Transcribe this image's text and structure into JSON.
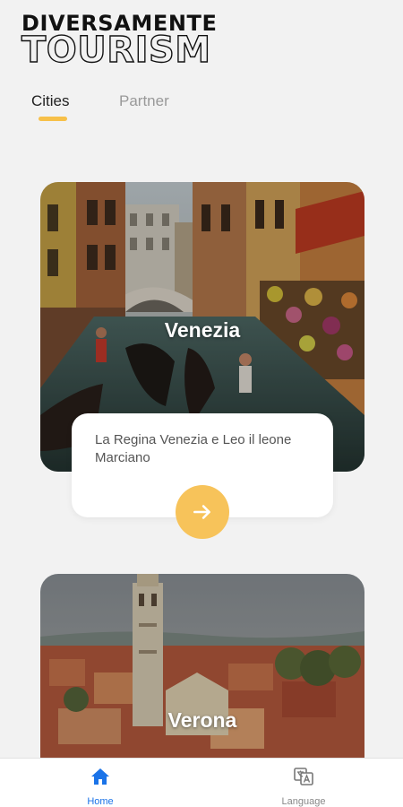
{
  "app": {
    "logo_line1": "DIVERSAMENTE",
    "logo_line2": "TOURISM"
  },
  "tabs": [
    {
      "label": "Cities",
      "active": true
    },
    {
      "label": "Partner",
      "active": false
    }
  ],
  "colors": {
    "accent": "#f7c049",
    "nav_active": "#1a73e8",
    "background": "#f2f2f2"
  },
  "cities": [
    {
      "name": "Venezia",
      "description": "La Regina Venezia e Leo il leone Marciano",
      "action_icon": "arrow-right-icon"
    },
    {
      "name": "Verona"
    }
  ],
  "bottom_nav": [
    {
      "label": "Home",
      "icon": "home-icon",
      "active": true
    },
    {
      "label": "Language",
      "icon": "translate-icon",
      "active": false
    }
  ]
}
